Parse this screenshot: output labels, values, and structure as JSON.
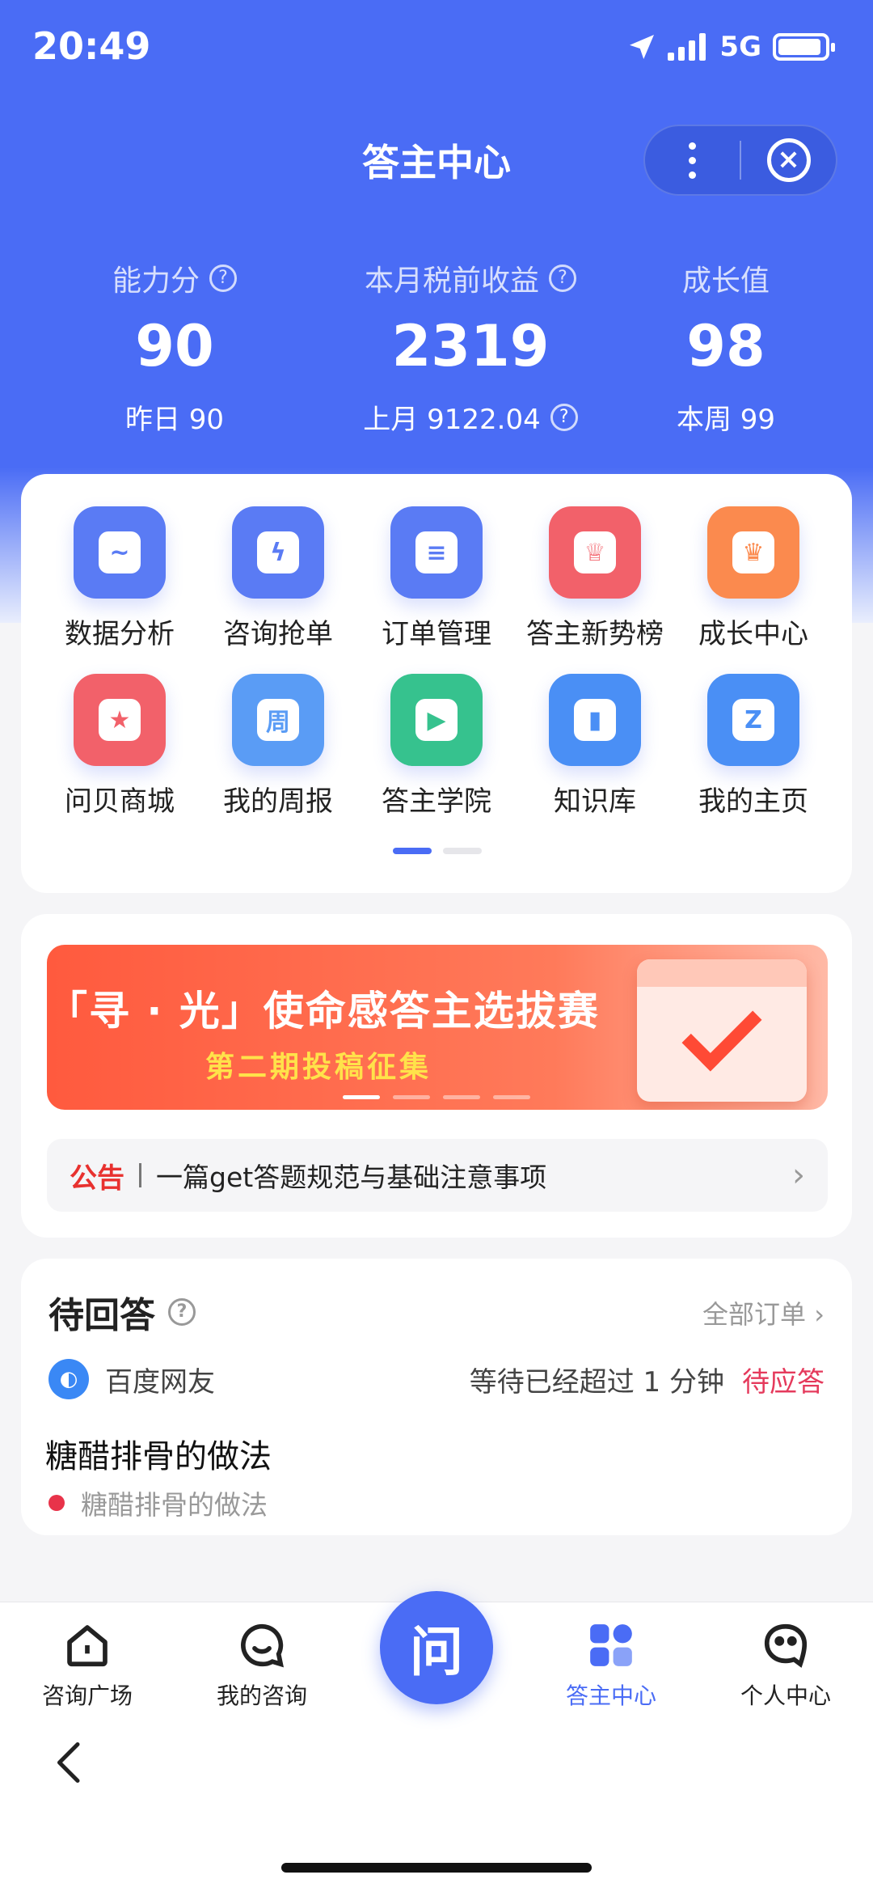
{
  "status_bar": {
    "time": "20:49",
    "network": "5G"
  },
  "header": {
    "title": "答主中心"
  },
  "stats": [
    {
      "label": "能力分",
      "value": "90",
      "sub": "昨日 90",
      "has_help": true,
      "sub_help": false
    },
    {
      "label": "本月税前收益",
      "value": "2319",
      "sub": "上月 9122.04",
      "has_help": true,
      "sub_help": true
    },
    {
      "label": "成长值",
      "value": "98",
      "sub": "本周 99",
      "has_help": false,
      "sub_help": false
    }
  ],
  "grid": [
    {
      "label": "数据分析",
      "icon": "chart-icon",
      "color": "#5a7bf4"
    },
    {
      "label": "咨询抢单",
      "icon": "lightning-icon",
      "color": "#5a7bf4"
    },
    {
      "label": "订单管理",
      "icon": "document-icon",
      "color": "#5a7bf4"
    },
    {
      "label": "答主新势榜",
      "icon": "trophy-icon",
      "color": "#f2616a"
    },
    {
      "label": "成长中心",
      "icon": "crown-icon",
      "color": "#fb8a4e"
    },
    {
      "label": "问贝商城",
      "icon": "shell-shop-icon",
      "color": "#f2616a"
    },
    {
      "label": "我的周报",
      "icon": "calendar-icon",
      "color": "#5a9cf5"
    },
    {
      "label": "答主学院",
      "icon": "video-play-icon",
      "color": "#36c28e"
    },
    {
      "label": "知识库",
      "icon": "book-icon",
      "color": "#4a8ff5"
    },
    {
      "label": "我的主页",
      "icon": "star-icon",
      "color": "#4a8ff5"
    }
  ],
  "grid_pager_pages": 2,
  "banner": {
    "title": "「寻 · 光」使命感答主选拔赛",
    "subtitle": "第二期投稿征集",
    "pages": 4
  },
  "notice": {
    "tag": "公告",
    "text": "一篇get答题规范与基础注意事项"
  },
  "pending": {
    "title": "待回答",
    "all_orders": "全部订单",
    "user": "百度网友",
    "wait_text": "等待已经超过 1 分钟",
    "status": "待应答",
    "question": "糖醋排骨的做法",
    "question_sub": "糖醋排骨的做法"
  },
  "tabbar": {
    "tabs": [
      {
        "label": "咨询广场",
        "icon": "home-icon"
      },
      {
        "label": "我的咨询",
        "icon": "chat-icon"
      },
      {
        "label": "答主中心",
        "icon": "grid-apps-icon",
        "active": true
      },
      {
        "label": "个人中心",
        "icon": "face-icon"
      }
    ],
    "center": "问"
  },
  "colors": {
    "primary": "#4a6cf5",
    "danger": "#e8312f",
    "pending": "#e53a5c"
  }
}
